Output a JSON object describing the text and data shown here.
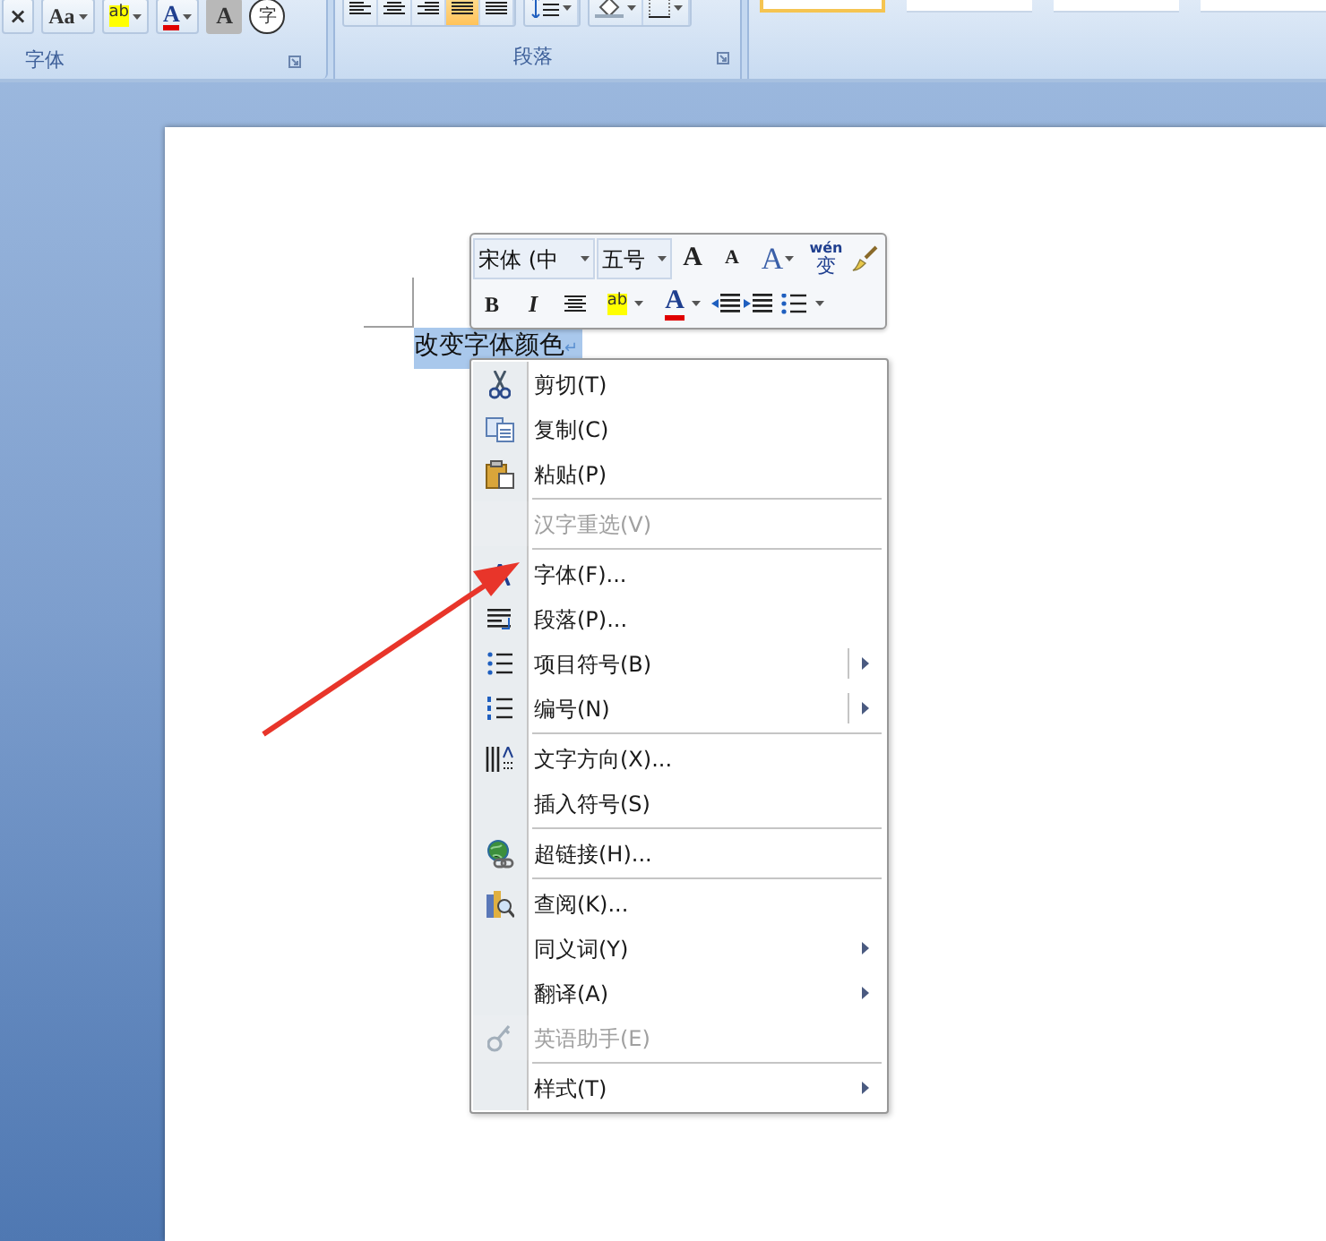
{
  "ribbon": {
    "font_group": {
      "label": "字体",
      "buttons": [
        {
          "kind": "clear",
          "glyph": "×"
        },
        {
          "kind": "case",
          "glyph": "Aa"
        },
        {
          "kind": "highlight",
          "glyph": "ab"
        },
        {
          "kind": "font_color",
          "glyph": "A"
        },
        {
          "kind": "shading",
          "glyph": "A"
        },
        {
          "kind": "enclose",
          "glyph": "字"
        }
      ]
    },
    "paragraph_group": {
      "label": "段落",
      "buttons": [
        {
          "kind": "align_left",
          "selected": false
        },
        {
          "kind": "center",
          "selected": false
        },
        {
          "kind": "align_right",
          "selected": false
        },
        {
          "kind": "justify",
          "selected": true
        },
        {
          "kind": "distributed",
          "selected": false
        },
        {
          "kind": "line_spacing",
          "selected": false
        },
        {
          "kind": "shading",
          "selected": false
        },
        {
          "kind": "border",
          "selected": false
        }
      ]
    },
    "styles_gallery": {
      "items": [
        {
          "selected": true
        },
        {
          "selected": false
        },
        {
          "selected": false
        },
        {
          "selected": false
        }
      ]
    }
  },
  "document": {
    "selected_text": "改变字体颜色",
    "paragraph_mark": "↵"
  },
  "mini_toolbar": {
    "font_field": "宋体 (中",
    "size_field": "五号",
    "row1": [
      {
        "kind": "grow",
        "glyph": "A"
      },
      {
        "kind": "shrink",
        "glyph": "A"
      },
      {
        "kind": "style",
        "glyph": "A"
      },
      {
        "kind": "phonetic",
        "glyph": "变",
        "ruby": "wén"
      },
      {
        "kind": "painter"
      }
    ],
    "row2": [
      {
        "kind": "bold",
        "glyph": "B"
      },
      {
        "kind": "italic",
        "glyph": "I"
      },
      {
        "kind": "center"
      },
      {
        "kind": "highlight",
        "glyph": "ab"
      },
      {
        "kind": "font_color",
        "glyph": "A"
      },
      {
        "kind": "outdent"
      },
      {
        "kind": "indent"
      },
      {
        "kind": "bullets"
      }
    ]
  },
  "context_menu": {
    "items": [
      {
        "label": "剪切(T)",
        "kind": "command",
        "disabled": false,
        "separator_before": false
      },
      {
        "label": "复制(C)",
        "kind": "command",
        "disabled": false,
        "separator_before": false
      },
      {
        "label": "粘贴(P)",
        "kind": "command",
        "disabled": false,
        "separator_before": false
      },
      {
        "label": "汉字重选(V)",
        "kind": "command",
        "disabled": true,
        "separator_before": true
      },
      {
        "label": "字体(F)...",
        "kind": "command",
        "disabled": false,
        "separator_before": true
      },
      {
        "label": "段落(P)...",
        "kind": "command",
        "disabled": false,
        "separator_before": false
      },
      {
        "label": "项目符号(B)",
        "kind": "split",
        "disabled": false,
        "separator_before": false
      },
      {
        "label": "编号(N)",
        "kind": "split",
        "disabled": false,
        "separator_before": false
      },
      {
        "label": "文字方向(X)...",
        "kind": "command",
        "disabled": false,
        "separator_before": true
      },
      {
        "label": "插入符号(S)",
        "kind": "command",
        "disabled": false,
        "separator_before": false
      },
      {
        "label": "超链接(H)...",
        "kind": "command",
        "disabled": false,
        "separator_before": true
      },
      {
        "label": "查阅(K)...",
        "kind": "command",
        "disabled": false,
        "separator_before": true
      },
      {
        "label": "同义词(Y)",
        "kind": "submenu",
        "disabled": false,
        "separator_before": false
      },
      {
        "label": "翻译(A)",
        "kind": "submenu",
        "disabled": false,
        "separator_before": false
      },
      {
        "label": "英语助手(E)",
        "kind": "command",
        "disabled": true,
        "separator_before": false
      },
      {
        "label": "样式(T)",
        "kind": "submenu",
        "disabled": false,
        "separator_before": true
      }
    ]
  }
}
